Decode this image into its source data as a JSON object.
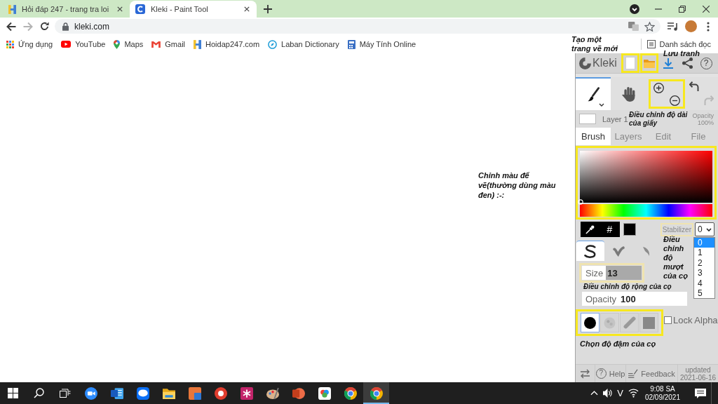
{
  "browser": {
    "tabs": [
      {
        "kind": "hoidap",
        "title": "Hỏi đáp 247 - trang tra loi",
        "selected": false
      },
      {
        "kind": "kleki",
        "title": "Kleki - Paint Tool",
        "selected": true
      }
    ],
    "nav": [
      {
        "kind": "back",
        "disabled": false
      },
      {
        "kind": "forward",
        "disabled": true
      },
      {
        "kind": "reload",
        "disabled": false
      }
    ],
    "address": "kleki.com",
    "bookmarks": [
      {
        "kind": "apps",
        "label": "Ứng dụng"
      },
      {
        "kind": "youtube",
        "label": "YouTube"
      },
      {
        "kind": "maps",
        "label": "Maps"
      },
      {
        "kind": "gmail",
        "label": "Gmail"
      },
      {
        "kind": "hoidap",
        "label": "Hoidap247.com"
      },
      {
        "kind": "laban",
        "label": "Laban Dictionary"
      },
      {
        "kind": "calculator",
        "label": "Máy Tính Online"
      }
    ],
    "reading_list": "Danh sách đọc"
  },
  "kleki": {
    "logo": "Kleki",
    "top_buttons": [
      {
        "kind": "new",
        "highlighted": true
      },
      {
        "kind": "open",
        "highlighted": true
      },
      {
        "kind": "download",
        "highlighted": false
      },
      {
        "kind": "share",
        "highlighted": false
      },
      {
        "kind": "help",
        "glyph": "?",
        "highlighted": false
      }
    ],
    "tools": [
      {
        "kind": "brush",
        "selected": true
      },
      {
        "kind": "hand",
        "selected": false
      }
    ],
    "zoom": {
      "highlighted": true
    },
    "history": [
      {
        "kind": "undo",
        "disabled": false
      },
      {
        "kind": "redo",
        "disabled": true
      }
    ],
    "layer": {
      "name": "Layer 1",
      "opacity_label": "Opacity",
      "opacity_value": "100%"
    },
    "tabs": [
      {
        "label": "Brush",
        "selected": true
      },
      {
        "label": "Layers",
        "selected": false
      },
      {
        "label": "Edit",
        "selected": false
      },
      {
        "label": "File",
        "selected": false
      }
    ],
    "color_picker": {
      "highlighted": true,
      "hex_button": "#"
    },
    "stabilizer": {
      "label": "Stabilizer",
      "highlighted": true,
      "highlight_faded": true,
      "value": "0",
      "expanded": true,
      "options": [
        {
          "label": "0",
          "selected": true
        },
        {
          "label": "1",
          "selected": false
        },
        {
          "label": "2",
          "selected": false
        },
        {
          "label": "3",
          "selected": false
        },
        {
          "label": "4",
          "selected": false
        },
        {
          "label": "5",
          "selected": false
        }
      ]
    },
    "brush_types": [
      {
        "kind": "pen",
        "selected": true
      },
      {
        "kind": "blend",
        "selected": false
      },
      {
        "kind": "sketchy",
        "selected": false
      }
    ],
    "sliders": [
      {
        "label": "Size",
        "value": "13",
        "level": 0.4,
        "highlighted": true,
        "highlight_faded": true
      },
      {
        "label": "Opacity",
        "value": "100",
        "level": 1,
        "highlighted": false
      }
    ],
    "shapes": {
      "highlighted": true,
      "items": [
        {
          "kind": "round",
          "selected": true
        },
        {
          "kind": "chalk",
          "selected": false
        },
        {
          "kind": "slanted",
          "selected": false
        },
        {
          "kind": "square",
          "selected": false
        }
      ]
    },
    "lock_alpha": {
      "label": "Lock Alpha",
      "checked": false
    },
    "footer": {
      "help_glyph": "?",
      "help": "Help",
      "feedback": "Feedback",
      "updated": "updated 2021-06-16"
    }
  },
  "annotations": [
    {
      "text": "Tạo một trang vẽ mới"
    },
    {
      "text": "Lưu tranh"
    },
    {
      "text": "Điều chỉnh độ dài của giấy"
    },
    {
      "text": "Chỉnh màu để vẽ(thường dùng màu đen) :-:"
    },
    {
      "text": "Điều chỉnh độ mượt của cọ"
    },
    {
      "text": "Điều chỉnh độ rộng của cọ"
    },
    {
      "text": "Chọn độ đậm của cọ"
    }
  ],
  "taskbar": {
    "apps": [
      {
        "kind": "video",
        "selected": false
      },
      {
        "kind": "document",
        "selected": false
      },
      {
        "kind": "chat",
        "selected": false
      },
      {
        "kind": "folder",
        "selected": false
      },
      {
        "kind": "tiles",
        "selected": false
      },
      {
        "kind": "ring",
        "selected": false
      },
      {
        "kind": "asterisk",
        "selected": false
      },
      {
        "kind": "palette",
        "selected": false
      },
      {
        "kind": "slides",
        "selected": false
      },
      {
        "kind": "photos",
        "selected": false
      },
      {
        "kind": "browser",
        "selected": false
      },
      {
        "kind": "browser",
        "selected": true
      }
    ],
    "language": "V",
    "time": "9:08 SA",
    "date": "02/09/2021"
  }
}
